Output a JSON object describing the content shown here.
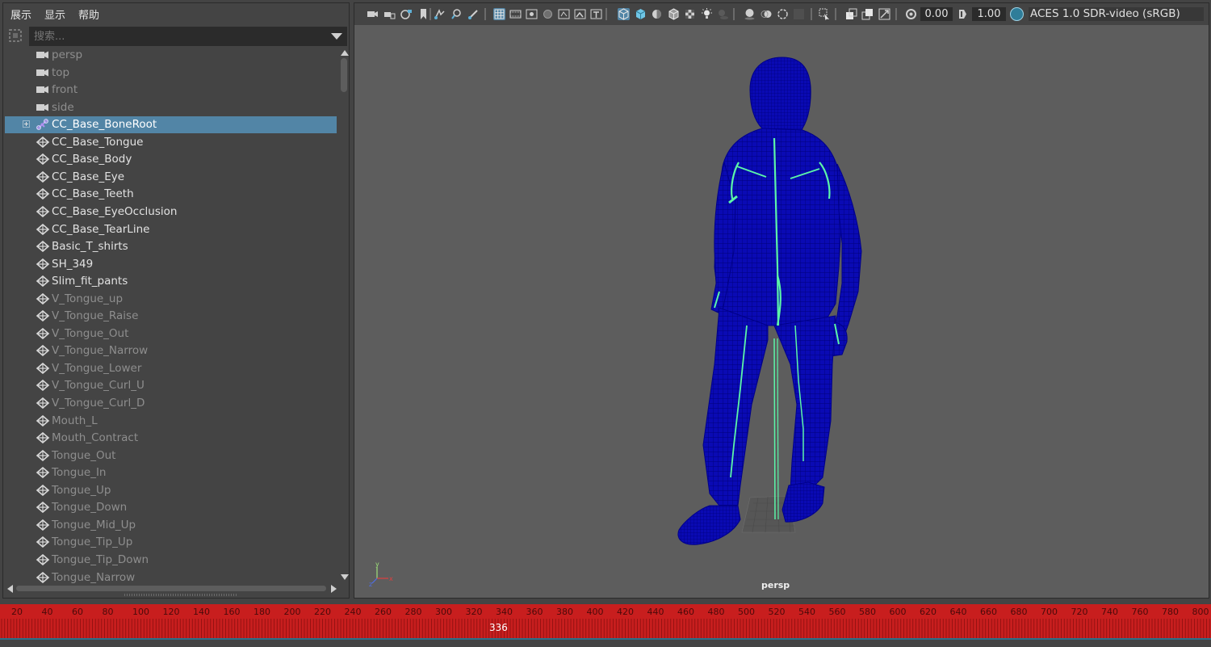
{
  "menu": {
    "items": [
      "展示",
      "显示",
      "帮助"
    ]
  },
  "search": {
    "placeholder": "搜索..."
  },
  "outliner": {
    "items": [
      {
        "label": "persp",
        "icon": "camera-icon",
        "state": "muted"
      },
      {
        "label": "top",
        "icon": "camera-icon",
        "state": "muted"
      },
      {
        "label": "front",
        "icon": "camera-icon",
        "state": "muted"
      },
      {
        "label": "side",
        "icon": "camera-icon",
        "state": "muted"
      },
      {
        "label": "CC_Base_BoneRoot",
        "icon": "joint-icon",
        "state": "selected",
        "expandable": true
      },
      {
        "label": "CC_Base_Tongue",
        "icon": "mesh-icon",
        "state": "normal"
      },
      {
        "label": "CC_Base_Body",
        "icon": "mesh-icon",
        "state": "normal"
      },
      {
        "label": "CC_Base_Eye",
        "icon": "mesh-icon",
        "state": "normal"
      },
      {
        "label": "CC_Base_Teeth",
        "icon": "mesh-icon",
        "state": "normal"
      },
      {
        "label": "CC_Base_EyeOcclusion",
        "icon": "mesh-icon",
        "state": "normal"
      },
      {
        "label": "CC_Base_TearLine",
        "icon": "mesh-icon",
        "state": "normal"
      },
      {
        "label": "Basic_T_shirts",
        "icon": "mesh-icon",
        "state": "normal"
      },
      {
        "label": "SH_349",
        "icon": "mesh-icon",
        "state": "normal"
      },
      {
        "label": "Slim_fit_pants",
        "icon": "mesh-icon",
        "state": "normal"
      },
      {
        "label": "V_Tongue_up",
        "icon": "mesh-icon",
        "state": "muted"
      },
      {
        "label": "V_Tongue_Raise",
        "icon": "mesh-icon",
        "state": "muted"
      },
      {
        "label": "V_Tongue_Out",
        "icon": "mesh-icon",
        "state": "muted"
      },
      {
        "label": "V_Tongue_Narrow",
        "icon": "mesh-icon",
        "state": "muted"
      },
      {
        "label": "V_Tongue_Lower",
        "icon": "mesh-icon",
        "state": "muted"
      },
      {
        "label": "V_Tongue_Curl_U",
        "icon": "mesh-icon",
        "state": "muted"
      },
      {
        "label": "V_Tongue_Curl_D",
        "icon": "mesh-icon",
        "state": "muted"
      },
      {
        "label": "Mouth_L",
        "icon": "mesh-icon",
        "state": "muted"
      },
      {
        "label": "Mouth_Contract",
        "icon": "mesh-icon",
        "state": "muted"
      },
      {
        "label": "Tongue_Out",
        "icon": "mesh-icon",
        "state": "muted"
      },
      {
        "label": "Tongue_In",
        "icon": "mesh-icon",
        "state": "muted"
      },
      {
        "label": "Tongue_Up",
        "icon": "mesh-icon",
        "state": "muted"
      },
      {
        "label": "Tongue_Down",
        "icon": "mesh-icon",
        "state": "muted"
      },
      {
        "label": "Tongue_Mid_Up",
        "icon": "mesh-icon",
        "state": "muted"
      },
      {
        "label": "Tongue_Tip_Up",
        "icon": "mesh-icon",
        "state": "muted"
      },
      {
        "label": "Tongue_Tip_Down",
        "icon": "mesh-icon",
        "state": "muted"
      },
      {
        "label": "Tongue_Narrow",
        "icon": "mesh-icon",
        "state": "muted"
      }
    ]
  },
  "viewport": {
    "exposure": "0.00",
    "gamma": "1.00",
    "color_space": "ACES 1.0 SDR-video (sRGB)",
    "camera_label": "persp",
    "wire_color": "#0a0ab4",
    "skeleton_color": "#5cf5a8"
  },
  "timeline": {
    "tick_labels": [
      "20",
      "40",
      "60",
      "80",
      "100",
      "120",
      "140",
      "160",
      "180",
      "200",
      "220",
      "240",
      "260",
      "280",
      "300",
      "320",
      "340",
      "360",
      "380",
      "400",
      "420",
      "440",
      "460",
      "480",
      "500",
      "520",
      "540",
      "560",
      "580",
      "600",
      "620",
      "640",
      "660",
      "680",
      "700",
      "720",
      "740",
      "760",
      "780",
      "800"
    ],
    "current_frame": "336",
    "bar_color": "#c81e1e"
  },
  "colors": {
    "panel_bg": "#444444",
    "viewport_bg": "#5d5d5d",
    "selection": "#5285a6"
  }
}
